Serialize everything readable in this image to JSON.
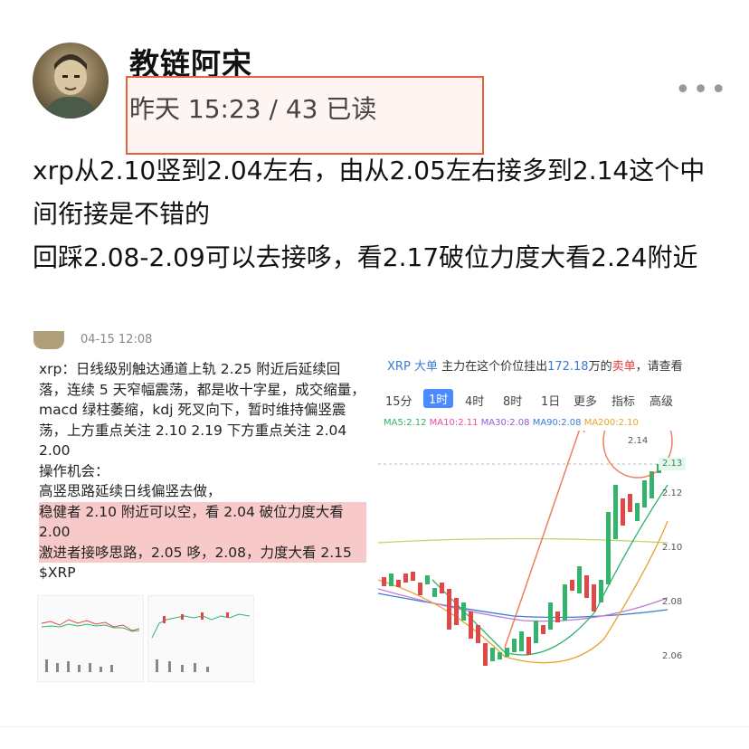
{
  "post": {
    "author": "教链阿宋",
    "meta": "昨天 15:23 / 43 已读",
    "more_icon": "more-dots-icon",
    "paragraph1": "xrp从2.10竖到2.04左右，由从2.05左右接多到2.14这个中间衔接是不错的",
    "paragraph2": "回踩2.08-2.09可以去接哆，看2.17破位力度大看2.24附近"
  },
  "left_image": {
    "header": "04-15 12:08",
    "lines": [
      "xrp：日线级别触达通道上轨 2.25 附近后延续回落，连续 5 天窄幅震荡，都是收十字星，成交缩量，macd 绿柱萎缩，kdj 死叉向下，暂时维持偏竖震荡，上方重点关注 2.10  2.19  下方重点关注 2.04  2.00",
      "操作机会：",
      "高竖思路延续日线偏竖去做，",
      "稳健者 2.10 附近可以空，看 2.04 破位力度大看 2.00",
      "激进者接哆思路，2.05 哆，2.08，力度大看 2.15",
      "$XRP"
    ]
  },
  "right_image": {
    "banner_tag": "XRP 大单",
    "banner_text_a": "主力在这个价位挂出",
    "banner_amount": "172.18",
    "banner_text_b": "万的",
    "banner_side": "卖单",
    "banner_text_c": "，请查看",
    "tabs": [
      "15分",
      "1时",
      "4时",
      "8时",
      "1日",
      "更多",
      "指标",
      "高级"
    ],
    "active_tab": "1时",
    "ma": [
      {
        "label": "MA5:2.12",
        "color": "#2db36b"
      },
      {
        "label": "MA10:2.11",
        "color": "#e94f9b"
      },
      {
        "label": "MA30:2.08",
        "color": "#9c5ad6"
      },
      {
        "label": "MA90:2.08",
        "color": "#3a7bd5"
      },
      {
        "label": "MA200:2.10",
        "color": "#e7a32b"
      }
    ],
    "y_labels": [
      "2.13",
      "2.12",
      "2.10",
      "2.08",
      "2.06"
    ],
    "high_label": "2.14",
    "colors": {
      "up": "#33b36b",
      "down": "#e04848",
      "annotation": "#e8603d"
    }
  }
}
